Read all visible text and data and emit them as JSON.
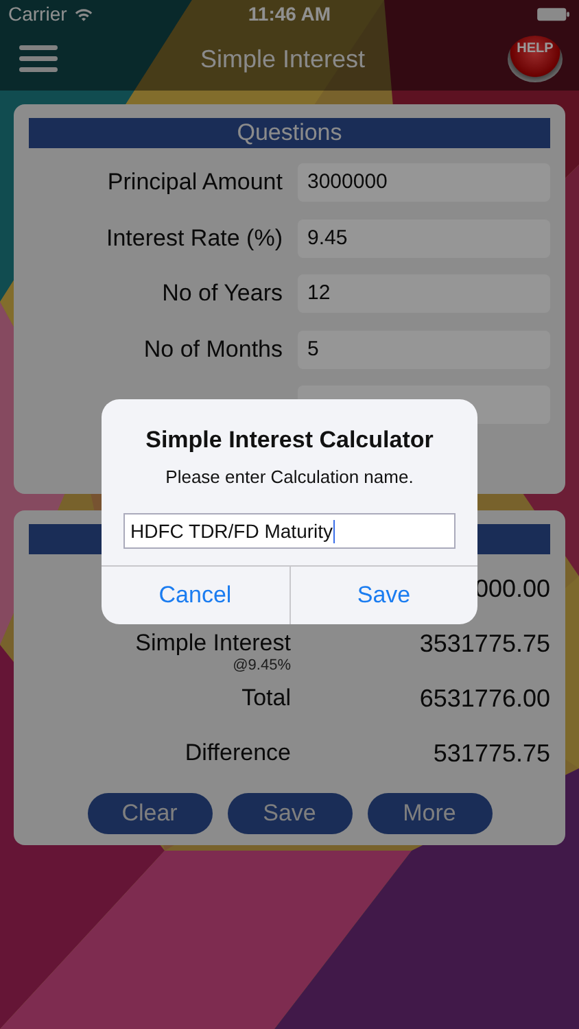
{
  "status_bar": {
    "carrier": "Carrier",
    "time": "11:46 AM"
  },
  "nav_bar": {
    "title": "Simple Interest",
    "help_label": "HELP"
  },
  "questions": {
    "title": "Questions",
    "fields": [
      {
        "label": "Principal Amount",
        "value": "3000000"
      },
      {
        "label": "Interest Rate (%)",
        "value": "9.45"
      },
      {
        "label": "No of Years",
        "value": "12"
      },
      {
        "label": "No of Months",
        "value": "5"
      },
      {
        "kind": "covered"
      }
    ]
  },
  "results": {
    "rows": [
      {
        "value": "000.00"
      },
      {
        "label": "Simple Interest",
        "note": "@9.45%",
        "value": "3531775.75"
      },
      {
        "label": "Total",
        "value": "6531776.00"
      },
      {
        "label": "Difference",
        "value": "531775.75"
      }
    ],
    "buttons": [
      "Clear",
      "Save",
      "More"
    ]
  },
  "dialog": {
    "title": "Simple Interest Calculator",
    "message": "Please enter Calculation name.",
    "input_value": "HDFC TDR/FD Maturity",
    "buttons": [
      "Cancel",
      "Save"
    ]
  }
}
